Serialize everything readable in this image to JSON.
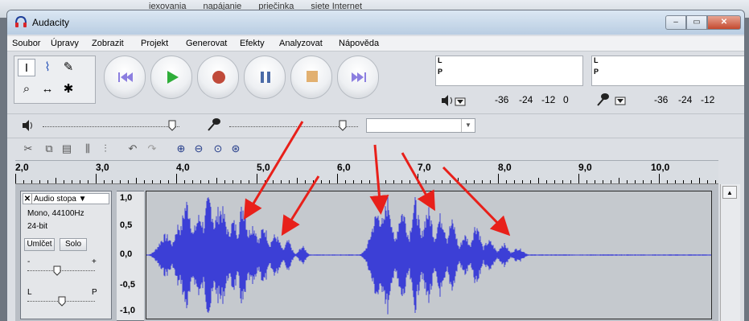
{
  "background_menu": [
    "iexovania",
    "napájanie",
    "priečinka",
    "siete Internet"
  ],
  "window": {
    "title": "Audacity",
    "controls": {
      "minimize": "–",
      "maximize": "▭",
      "close": "✕"
    }
  },
  "menu": [
    "Soubor",
    "Úpravy",
    "Zobrazit",
    "Projekt",
    "Generovat",
    "Efekty",
    "Analyzovat",
    "Nápověda"
  ],
  "tools": [
    {
      "name": "selection-tool",
      "glyph": "I"
    },
    {
      "name": "envelope-tool",
      "glyph": "⌇"
    },
    {
      "name": "draw-tool",
      "glyph": "✎"
    },
    {
      "name": "zoom-tool",
      "glyph": "⌕"
    },
    {
      "name": "timeshift-tool",
      "glyph": "↔"
    },
    {
      "name": "multi-tool",
      "glyph": "✱"
    }
  ],
  "transport": [
    "skip-to-start",
    "play",
    "record",
    "pause",
    "stop",
    "skip-to-end"
  ],
  "meters": {
    "left_label": "L",
    "right_label": "P",
    "scale": [
      "-36",
      "-24",
      "-12",
      "0"
    ],
    "scale_right": [
      "-36",
      "-24",
      "-12"
    ]
  },
  "mixer": {
    "device_value": ""
  },
  "ruler": {
    "labels": [
      "2,0",
      "3,0",
      "4,0",
      "5,0",
      "6,0",
      "7,0",
      "8,0",
      "9,0",
      "10,0"
    ]
  },
  "track": {
    "name": "Audio stopa",
    "close": "✕",
    "dropdown": "▼",
    "info": [
      "Mono, 44100Hz",
      "24-bit"
    ],
    "mute": "Umlčet",
    "solo": "Solo",
    "gain_minus": "-",
    "gain_plus": "+",
    "pan_left": "L",
    "pan_right": "P",
    "scale": [
      "1,0",
      "0,5",
      "0,0",
      "-0,5",
      "-1,0"
    ]
  },
  "colors": {
    "waveform": "#3c3fd6",
    "arrow": "#e8201a",
    "play": "#2fae3a",
    "record": "#c04a3a"
  }
}
